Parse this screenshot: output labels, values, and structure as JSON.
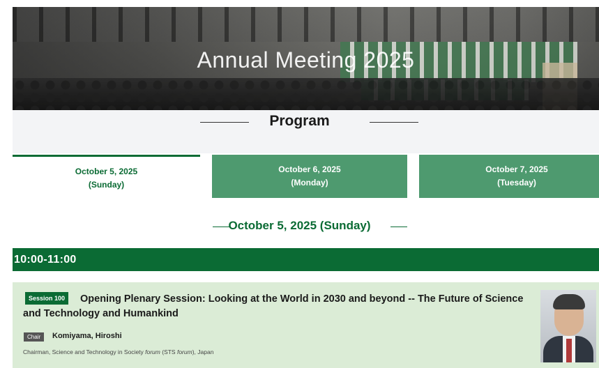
{
  "hero": {
    "title": "Annual Meeting 2025"
  },
  "program": {
    "title": "Program"
  },
  "tabs": [
    {
      "date": "October 5, 2025",
      "day": "(Sunday)",
      "active": true
    },
    {
      "date": "October 6, 2025",
      "day": "(Monday)",
      "active": false
    },
    {
      "date": "October 7, 2025",
      "day": "(Tuesday)",
      "active": false
    }
  ],
  "date_heading": "October 5, 2025 (Sunday)",
  "time_slot": "10:00-11:00",
  "session": {
    "badge": "Session 100",
    "title": "Opening Plenary Session: Looking at the World in 2030 and beyond -- The Future of Science and Technology and Humankind",
    "chair_label": "Chair",
    "chair_name": "Komiyama, Hiroshi",
    "chair_affil_pre": "Chairman, Science and Technology in Society ",
    "chair_affil_forum1": "forum",
    "chair_affil_mid": " (STS ",
    "chair_affil_forum2": "forum",
    "chair_affil_post": "), Japan"
  },
  "colors": {
    "primary_green": "#0b6b34",
    "tab_inactive": "#4e9a6f",
    "card_bg": "#dbecd6"
  }
}
